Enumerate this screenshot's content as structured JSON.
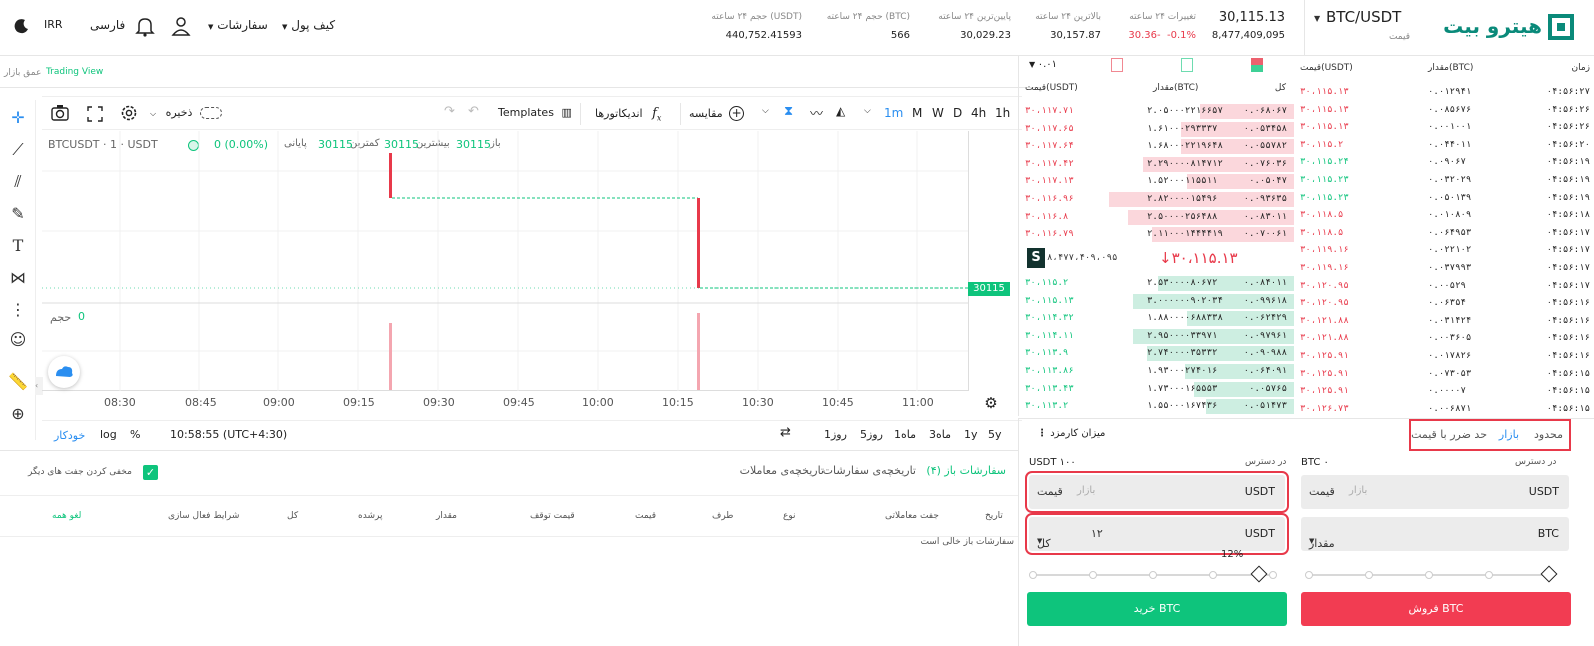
{
  "topbar": {
    "logo_text": "هیترو بیت",
    "pair": "BTC/USDT",
    "pair_sub": "قیمت",
    "last_price": "30,115.13",
    "last_price_sub": "8,477,409,095",
    "change_label": "تغییرات ۲۴ ساعته",
    "change_pct": "-0.1%",
    "change_abs": "30.36-",
    "high_label": "بالاترین ۲۴ ساعته",
    "high_value": "30,157.87",
    "low_label": "پایین‌ترین ۲۴ ساعته",
    "low_value": "30,029.23",
    "vol_btc_label": "حجم ۲۴ ساعته (BTC)",
    "vol_btc_value": "566",
    "vol_usdt_label": "حجم ۲۴ ساعته (USDT)",
    "vol_usdt_value": "440,752.41593",
    "wallet": "کیف پول",
    "orders": "سفارشات",
    "language": "فارسی",
    "currency": "IRR"
  },
  "chart_links": {
    "tradingview": "Trading View",
    "depth": "عمق بازار"
  },
  "chart_toolbar": {
    "intervals": [
      "1h",
      "4h",
      "D",
      "W",
      "M",
      "1m"
    ],
    "compare": "مقایسه",
    "indicators": "اندیکاتورها",
    "templates": "Templates",
    "save": "ذخیره"
  },
  "legend": {
    "symbol": "BTCUSDT · 1 · USDT",
    "open_label": "باز",
    "open": "30115",
    "high_label": "بیشترین",
    "high": "30115",
    "low_label": "کمترین",
    "low": "30115",
    "close_label": "پایانی",
    "close": "30115",
    "change": "0 (0.00%)",
    "volume_label": "حجم",
    "volume": "0",
    "price_tag": "30115"
  },
  "time_axis": [
    "08:30",
    "08:45",
    "09:00",
    "09:15",
    "09:30",
    "09:45",
    "10:00",
    "10:15",
    "10:30",
    "10:45",
    "11:00"
  ],
  "range_bar": {
    "ranges": [
      "5y",
      "1y",
      "3ماه",
      "1ماه",
      "5روز",
      "1روز"
    ],
    "clock": "10:58:55 (UTC+4:30)",
    "pct": "%",
    "log": "log",
    "auto": "خودکار"
  },
  "orders_panel": {
    "tab_open": "سفارشات باز (۴)",
    "tab_history": "تاریخچه‌ی سفارشات",
    "tab_trades": "تاریخچه‌ی معاملات",
    "hide_others": "مخفی کردن جفت های دیگر",
    "headers": [
      "تاریخ",
      "جفت معاملاتی",
      "نوع",
      "طرف",
      "قیمت",
      "قیمت توقف",
      "مقدار",
      "پرشده",
      "کل",
      "شرایط فعال سازی"
    ],
    "cancel_all": "لغو همه",
    "empty": "سفارشات باز خالی است"
  },
  "book": {
    "tick": "۰.۰۱",
    "col_total": "کل",
    "col_amount": "مقدار(BTC)",
    "col_price": "قیمت(USDT)",
    "asks": [
      {
        "total": "۰.۰۶۸۰۶۷",
        "amount": "۲.۰۵۰۰۰۲۲۱۶۶۵۷",
        "price": "۳۰،۱۱۷.۷۱",
        "fill": 0.5
      },
      {
        "total": "۰.۰۵۳۴۵۸",
        "amount": "۱.۶۱۰۰۰۲۹۳۳۳۷",
        "price": "۳۰،۱۱۷.۶۵",
        "fill": 0.6
      },
      {
        "total": "۰.۰۵۵۷۸۲",
        "amount": "۱.۶۸۰۰۰۲۲۱۹۶۴۸",
        "price": "۳۰،۱۱۷.۶۴",
        "fill": 0.6
      },
      {
        "total": "۰.۰۷۶۰۳۶",
        "amount": "۲.۲۹۰۰۰۰۸۱۴۷۱۲",
        "price": "۳۰،۱۱۷.۴۲",
        "fill": 0.8
      },
      {
        "total": "۰.۰۵۰۴۷",
        "amount": "۱.۵۲۰۰۰۱۱۵۵۱۱",
        "price": "۳۰،۱۱۷.۱۳",
        "fill": 0.57
      },
      {
        "total": "۰.۰۹۳۶۳۵",
        "amount": "۲.۸۲۰۰۰۰۱۵۴۹۶",
        "price": "۳۰،۱۱۶.۹۶",
        "fill": 0.98
      },
      {
        "total": "۰.۰۸۳۰۱۱",
        "amount": "۲.۵۰۰۰۰۲۵۶۴۸۸",
        "price": "۳۰،۱۱۶.۸",
        "fill": 0.88
      },
      {
        "total": "۰.۰۷۰۰۶۱",
        "amount": "۲.۱۱۰۰۰۱۴۴۴۴۱۹",
        "price": "۳۰،۱۱۶.۷۹",
        "fill": 0.75
      }
    ],
    "mid_price": "۳۰،۱۱۵.۱۳",
    "mid_sub": "۸،۴۷۷،۴۰۹،۰۹۵",
    "bids": [
      {
        "total": "۰.۰۸۴۰۱۱",
        "amount": "۲.۵۳۰۰۰۰۸۰۶۷۲",
        "price": "۳۰،۱۱۵.۲",
        "fill": 0.72
      },
      {
        "total": "۰.۰۹۹۶۱۸",
        "amount": "۳.۰۰۰۰۰۰۹۰۲۰۳۴",
        "price": "۳۰،۱۱۵.۱۳",
        "fill": 0.85
      },
      {
        "total": "۰.۰۶۲۴۲۹",
        "amount": "۱.۸۸۰۰۰۰۶۸۸۳۳۸",
        "price": "۳۰،۱۱۴.۳۲",
        "fill": 0.57
      },
      {
        "total": "۰.۰۹۷۹۶۱",
        "amount": "۲.۹۵۰۰۰۰۳۳۹۷۱",
        "price": "۳۰،۱۱۴.۱۱",
        "fill": 0.85
      },
      {
        "total": "۰.۰۹۰۹۸۸",
        "amount": "۲.۷۴۰۰۰۰۳۵۳۳۲",
        "price": "۳۰،۱۱۳.۹",
        "fill": 0.78
      },
      {
        "total": "۰.۰۶۴۰۹۱",
        "amount": "۱.۹۳۰۰۰۲۷۴۰۱۶",
        "price": "۳۰،۱۱۳.۸۶",
        "fill": 0.58
      },
      {
        "total": "۰.۰۵۷۶۵",
        "amount": "۱.۷۳۰۰۰۱۶۵۵۵۳",
        "price": "۳۰،۱۱۳.۴۳",
        "fill": 0.53
      },
      {
        "total": "۰.۰۵۱۴۷۳",
        "amount": "۱.۵۵۰۰۰۱۶۷۴۳۶",
        "price": "۳۰،۱۱۳.۲",
        "fill": 0.47
      }
    ]
  },
  "trades": {
    "col_time": "زمان",
    "col_amount": "مقدار(BTC)",
    "col_price": "قیمت(USDT)",
    "rows": [
      {
        "time": "۰۴:۵۶:۲۷",
        "amount": "۰.۰۱۲۹۴۱",
        "price": "۳۰،۱۱۵.۱۳",
        "side": "sell"
      },
      {
        "time": "۰۴:۵۶:۲۶",
        "amount": "۰.۰۸۵۶۷۶",
        "price": "۳۰،۱۱۵.۱۳",
        "side": "sell"
      },
      {
        "time": "۰۴:۵۶:۲۶",
        "amount": "۰.۰۰۱۰۰۱",
        "price": "۳۰،۱۱۵.۱۳",
        "side": "sell"
      },
      {
        "time": "۰۴:۵۶:۲۰",
        "amount": "۰.۰۴۴۰۱۱",
        "price": "۳۰،۱۱۵.۲",
        "side": "sell"
      },
      {
        "time": "۰۴:۵۶:۱۹",
        "amount": "۰.۰۹۰۶۷",
        "price": "۳۰،۱۱۵.۲۴",
        "side": "buy"
      },
      {
        "time": "۰۴:۵۶:۱۹",
        "amount": "۰.۰۳۲۰۲۹",
        "price": "۳۰،۱۱۵.۲۳",
        "side": "buy"
      },
      {
        "time": "۰۴:۵۶:۱۹",
        "amount": "۰.۰۵۰۱۳۹",
        "price": "۳۰،۱۱۵.۲۳",
        "side": "buy"
      },
      {
        "time": "۰۴:۵۶:۱۸",
        "amount": "۰.۰۱۰۸۰۹",
        "price": "۳۰،۱۱۸.۵",
        "side": "sell"
      },
      {
        "time": "۰۴:۵۶:۱۷",
        "amount": "۰.۰۶۴۹۵۳",
        "price": "۳۰،۱۱۸.۵",
        "side": "sell"
      },
      {
        "time": "۰۴:۵۶:۱۷",
        "amount": "۰.۰۲۲۱۰۲",
        "price": "۳۰،۱۱۹.۱۶",
        "side": "sell"
      },
      {
        "time": "۰۴:۵۶:۱۷",
        "amount": "۰.۰۳۷۹۹۳",
        "price": "۳۰،۱۱۹.۱۶",
        "side": "sell"
      },
      {
        "time": "۰۴:۵۶:۱۷",
        "amount": "۰.۰۰۵۲۹",
        "price": "۳۰،۱۲۰.۹۵",
        "side": "sell"
      },
      {
        "time": "۰۴:۵۶:۱۶",
        "amount": "۰.۰۶۳۵۴",
        "price": "۳۰،۱۲۰.۹۵",
        "side": "sell"
      },
      {
        "time": "۰۴:۵۶:۱۶",
        "amount": "۰.۰۳۱۴۲۴",
        "price": "۳۰،۱۲۱.۸۸",
        "side": "sell"
      },
      {
        "time": "۰۴:۵۶:۱۶",
        "amount": "۰.۰۰۳۶۰۵",
        "price": "۳۰،۱۲۱.۸۸",
        "side": "sell"
      },
      {
        "time": "۰۴:۵۶:۱۶",
        "amount": "۰.۰۱۷۸۲۶",
        "price": "۳۰،۱۲۵.۹۱",
        "side": "sell"
      },
      {
        "time": "۰۴:۵۶:۱۵",
        "amount": "۰.۰۷۳۰۵۳",
        "price": "۳۰،۱۲۵.۹۱",
        "side": "sell"
      },
      {
        "time": "۰۴:۵۶:۱۵",
        "amount": "۰.۰۰۰۰۷",
        "price": "۳۰،۱۲۵.۹۱",
        "side": "sell"
      },
      {
        "time": "۰۴:۵۶:۱۵",
        "amount": "۰.۰۰۶۸۷۱",
        "price": "۳۰،۱۲۶.۷۳",
        "side": "sell"
      }
    ]
  },
  "form": {
    "tab_limit": "محدود",
    "tab_market": "بازار",
    "tab_stop": "حد ضرر با قیمت",
    "fee": "میزان کارمزد",
    "sell_avail_label": "در دسترس",
    "sell_avail": "BTC ۰",
    "buy_avail_label": "در دسترس",
    "buy_avail": "USDT ۱۰۰",
    "sell_price_unit": "USDT",
    "sell_price_hint": "بازار",
    "sell_price_label": "قیمت",
    "sell_amt_unit": "BTC",
    "sell_amt_label": "مقدار",
    "buy_price_unit": "USDT",
    "buy_price_hint": "بازار",
    "buy_price_label": "قیمت",
    "buy_total_unit": "USDT",
    "buy_total_value": "۱۲",
    "buy_total_label": "کل",
    "buy_slider_pct": "12%",
    "buy_slider_value": 0.12,
    "sell_slider_value": 1.0,
    "sell_button": "فروش BTC",
    "buy_button": "خرید BTC"
  },
  "colors": {
    "green": "#0ec47c",
    "red": "#e8394a",
    "brand": "#0a8a7a"
  }
}
